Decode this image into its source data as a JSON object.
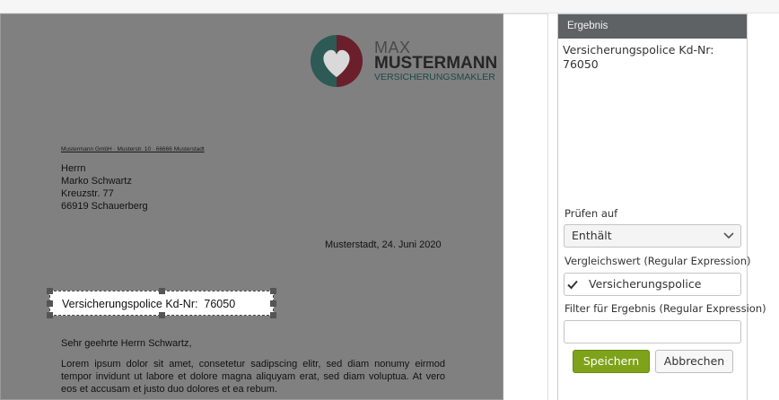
{
  "document": {
    "logo": {
      "line1": "MAX",
      "line2": "MUSTERMANN",
      "line3": "VERSICHERUNGSMAKLER",
      "icon": "heart-logo-icon"
    },
    "sender_line": "Mustermann GmbH · Musterstr. 10 · 66666 Musterstadt",
    "recipient": [
      "Herrn",
      "Marko Schwartz",
      "Kreuzstr. 77",
      "66919 Schauerberg"
    ],
    "date": "Musterstadt, 24. Juni 2020",
    "selection_text": "Versicherungspolice Kd-Nr:  76050",
    "salutation": "Sehr geehrte Herrn Schwartz,",
    "body": "Lorem ipsum dolor sit amet, consetetur sadipscing elitr, sed diam nonumy eirmod tempor invidunt ut labore et dolore magna aliquyam erat, sed diam voluptua. At vero eos et accusam et justo duo dolores et ea rebum."
  },
  "panel": {
    "title": "Ergebnis",
    "result_lines": [
      "Versicherungspolice Kd-Nr:",
      "76050"
    ],
    "check_label": "Prüfen auf",
    "check_value": "Enthält",
    "compare_label": "Vergleichswert (Regular Expression)",
    "compare_value": "Versicherungspolice",
    "filter_label": "Filter für Ergebnis (Regular Expression)",
    "filter_value": "",
    "save_label": "Speichern",
    "cancel_label": "Abbrechen"
  },
  "colors": {
    "header_bg": "#5e6264",
    "save_bg": "#7ea21a",
    "doc_bg": "#808080"
  }
}
